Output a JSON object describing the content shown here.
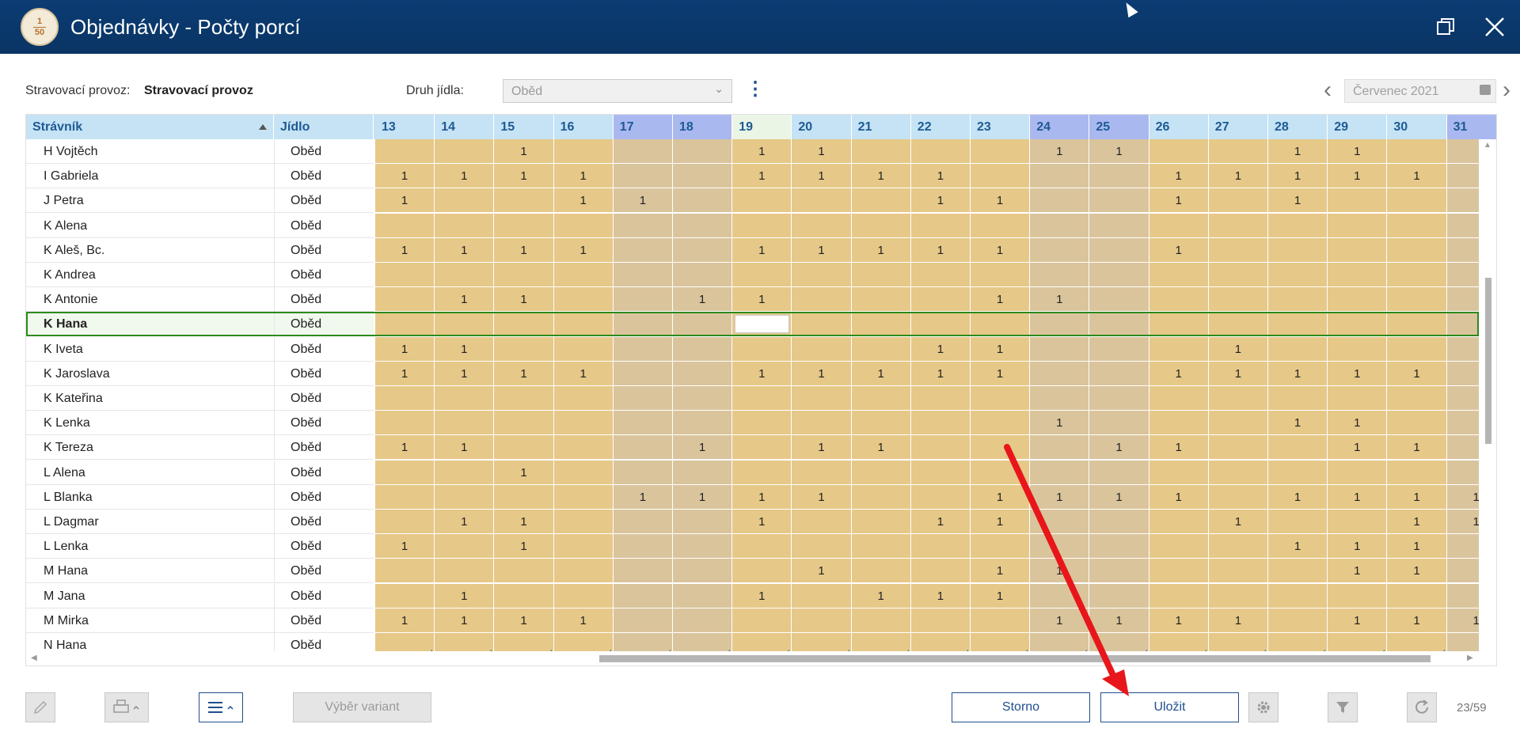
{
  "window": {
    "title": "Objednávky - Počty porcí",
    "icon_text_top": "1",
    "icon_text_bottom": "50"
  },
  "filters": {
    "provoz_label": "Stravovací provoz:",
    "provoz_value": "Stravovací provoz",
    "druh_label": "Druh jídla:",
    "druh_value": "Oběd",
    "month_value": "Červenec 2021"
  },
  "columns": {
    "name": "Strávník",
    "food": "Jídlo"
  },
  "days": [
    {
      "day": "13",
      "type": "work"
    },
    {
      "day": "14",
      "type": "work"
    },
    {
      "day": "15",
      "type": "work"
    },
    {
      "day": "16",
      "type": "work"
    },
    {
      "day": "17",
      "type": "weekend"
    },
    {
      "day": "18",
      "type": "weekend"
    },
    {
      "day": "19",
      "type": "today"
    },
    {
      "day": "20",
      "type": "work"
    },
    {
      "day": "21",
      "type": "work"
    },
    {
      "day": "22",
      "type": "work"
    },
    {
      "day": "23",
      "type": "work"
    },
    {
      "day": "24",
      "type": "weekend"
    },
    {
      "day": "25",
      "type": "weekend"
    },
    {
      "day": "26",
      "type": "work"
    },
    {
      "day": "27",
      "type": "work"
    },
    {
      "day": "28",
      "type": "work"
    },
    {
      "day": "29",
      "type": "work"
    },
    {
      "day": "30",
      "type": "work"
    },
    {
      "day": "31",
      "type": "weekend"
    }
  ],
  "rows": [
    {
      "name": "H Vojtěch",
      "food": "Oběd",
      "v": [
        "",
        "",
        "1",
        "",
        "",
        "",
        "1",
        "1",
        "",
        "",
        "",
        "1",
        "1",
        "",
        "",
        "1",
        "1",
        "",
        ""
      ]
    },
    {
      "name": "I Gabriela",
      "food": "Oběd",
      "v": [
        "1",
        "1",
        "1",
        "1",
        "",
        "",
        "1",
        "1",
        "1",
        "1",
        "",
        "",
        "",
        "1",
        "1",
        "1",
        "1",
        "1",
        ""
      ]
    },
    {
      "name": "J Petra",
      "food": "Oběd",
      "v": [
        "1",
        "",
        "",
        "1",
        "1",
        "",
        "",
        "",
        "",
        "1",
        "1",
        "",
        "",
        "1",
        "",
        "1",
        "",
        "",
        ""
      ]
    },
    {
      "name": "K Alena",
      "food": "Oběd",
      "v": [
        "",
        "",
        "",
        "",
        "",
        "",
        "",
        "",
        "",
        "",
        "",
        "",
        "",
        "",
        "",
        "",
        "",
        "",
        ""
      ]
    },
    {
      "name": "K Aleš, Bc.",
      "food": "Oběd",
      "v": [
        "1",
        "1",
        "1",
        "1",
        "",
        "",
        "1",
        "1",
        "1",
        "1",
        "1",
        "",
        "",
        "1",
        "",
        "",
        "",
        "",
        ""
      ]
    },
    {
      "name": "K Andrea",
      "food": "Oběd",
      "v": [
        "",
        "",
        "",
        "",
        "",
        "",
        "",
        "",
        "",
        "",
        "",
        "",
        "",
        "",
        "",
        "",
        "",
        "",
        ""
      ]
    },
    {
      "name": "K Antonie",
      "food": "Oběd",
      "v": [
        "",
        "1",
        "1",
        "",
        "",
        "1",
        "1",
        "",
        "",
        "",
        "1",
        "1",
        "",
        "",
        "",
        "",
        "",
        "",
        ""
      ]
    },
    {
      "name": "K Hana",
      "food": "Oběd",
      "v": [
        "",
        "",
        "",
        "",
        "",
        "",
        "",
        "",
        "",
        "",
        "",
        "",
        "",
        "",
        "",
        "",
        "",
        "",
        ""
      ],
      "selected": true
    },
    {
      "name": "K Iveta",
      "food": "Oběd",
      "v": [
        "1",
        "1",
        "",
        "",
        "",
        "",
        "",
        "",
        "",
        "1",
        "1",
        "",
        "",
        "",
        "1",
        "",
        "",
        "",
        ""
      ]
    },
    {
      "name": "K Jaroslava",
      "food": "Oběd",
      "v": [
        "1",
        "1",
        "1",
        "1",
        "",
        "",
        "1",
        "1",
        "1",
        "1",
        "1",
        "",
        "",
        "1",
        "1",
        "1",
        "1",
        "1",
        ""
      ]
    },
    {
      "name": "K Kateřina",
      "food": "Oběd",
      "v": [
        "",
        "",
        "",
        "",
        "",
        "",
        "",
        "",
        "",
        "",
        "",
        "",
        "",
        "",
        "",
        "",
        "",
        "",
        ""
      ]
    },
    {
      "name": "K Lenka",
      "food": "Oběd",
      "v": [
        "",
        "",
        "",
        "",
        "",
        "",
        "",
        "",
        "",
        "",
        "",
        "1",
        "",
        "",
        "",
        "1",
        "1",
        "",
        ""
      ]
    },
    {
      "name": "K Tereza",
      "food": "Oběd",
      "v": [
        "1",
        "1",
        "",
        "",
        "",
        "1",
        "",
        "1",
        "1",
        "",
        "",
        "",
        "1",
        "1",
        "",
        "",
        "1",
        "1",
        ""
      ]
    },
    {
      "name": "L Alena",
      "food": "Oběd",
      "v": [
        "",
        "",
        "1",
        "",
        "",
        "",
        "",
        "",
        "",
        "",
        "",
        "",
        "",
        "",
        "",
        "",
        "",
        "",
        ""
      ]
    },
    {
      "name": "L Blanka",
      "food": "Oběd",
      "v": [
        "",
        "",
        "",
        "",
        "1",
        "1",
        "1",
        "1",
        "",
        "",
        "1",
        "1",
        "1",
        "1",
        "",
        "1",
        "1",
        "1",
        "1"
      ]
    },
    {
      "name": "L Dagmar",
      "food": "Oběd",
      "v": [
        "",
        "1",
        "1",
        "",
        "",
        "",
        "1",
        "",
        "",
        "1",
        "1",
        "",
        "",
        "",
        "1",
        "",
        "",
        "1",
        "1"
      ]
    },
    {
      "name": "L Lenka",
      "food": "Oběd",
      "v": [
        "1",
        "",
        "1",
        "",
        "",
        "",
        "",
        "",
        "",
        "",
        "",
        "",
        "",
        "",
        "",
        "1",
        "1",
        "1",
        ""
      ]
    },
    {
      "name": "M Hana",
      "food": "Oběd",
      "v": [
        "",
        "",
        "",
        "",
        "",
        "",
        "",
        "1",
        "",
        "",
        "1",
        "1",
        "",
        "",
        "",
        "",
        "1",
        "1",
        ""
      ]
    },
    {
      "name": "M Jana",
      "food": "Oběd",
      "v": [
        "",
        "1",
        "",
        "",
        "",
        "",
        "1",
        "",
        "1",
        "1",
        "1",
        "",
        "",
        "",
        "",
        "",
        "",
        "",
        ""
      ]
    },
    {
      "name": "M Mirka",
      "food": "Oběd",
      "v": [
        "1",
        "1",
        "1",
        "1",
        "",
        "",
        "",
        "",
        "",
        "",
        "",
        "1",
        "1",
        "1",
        "1",
        "",
        "1",
        "1",
        "1"
      ]
    },
    {
      "name": "N Hana",
      "food": "Oběd",
      "v": [
        "",
        "",
        "",
        "",
        "",
        "",
        "",
        "",
        "",
        "",
        "",
        "",
        "",
        "",
        "",
        "",
        "",
        "",
        ""
      ]
    }
  ],
  "footer": {
    "variant_button": "Výběr variant",
    "cancel_button": "Storno",
    "save_button": "Uložit",
    "page_counter": "23/59"
  },
  "colors": {
    "titlebar": "#0b3c73",
    "work_cell": "#e6c888",
    "weekend_cell": "#dac49c",
    "header_today": "#eaf5e6",
    "header_weekend": "#aab8f0",
    "header": "#c5e3f5",
    "selection": "#2c8a1e",
    "annotation_arrow": "#e8161b"
  }
}
